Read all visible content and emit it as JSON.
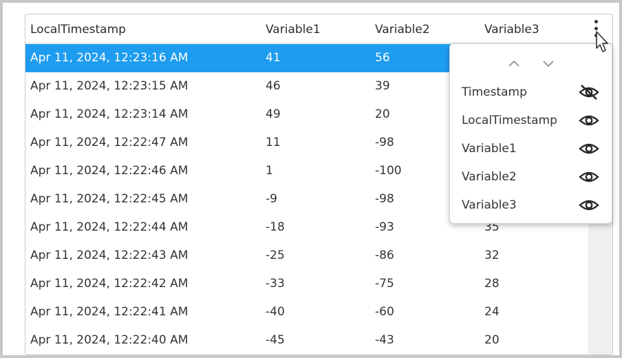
{
  "table": {
    "columns": [
      "LocalTimestamp",
      "Variable1",
      "Variable2",
      "Variable3"
    ],
    "rows": [
      [
        "Apr 11, 2024, 12:23:16 AM",
        "41",
        "56",
        ""
      ],
      [
        "Apr 11, 2024, 12:23:15 AM",
        "46",
        "39",
        ""
      ],
      [
        "Apr 11, 2024, 12:23:14 AM",
        "49",
        "20",
        ""
      ],
      [
        "Apr 11, 2024, 12:22:47 AM",
        "11",
        "-98",
        ""
      ],
      [
        "Apr 11, 2024, 12:22:46 AM",
        "1",
        "-100",
        ""
      ],
      [
        "Apr 11, 2024, 12:22:45 AM",
        "-9",
        "-98",
        ""
      ],
      [
        "Apr 11, 2024, 12:22:44 AM",
        "-18",
        "-93",
        "35"
      ],
      [
        "Apr 11, 2024, 12:22:43 AM",
        "-25",
        "-86",
        "32"
      ],
      [
        "Apr 11, 2024, 12:22:42 AM",
        "-33",
        "-75",
        "28"
      ],
      [
        "Apr 11, 2024, 12:22:41 AM",
        "-40",
        "-60",
        "24"
      ],
      [
        "Apr 11, 2024, 12:22:40 AM",
        "-45",
        "-43",
        "20"
      ]
    ],
    "selected_row": 0
  },
  "column_menu": {
    "items": [
      {
        "label": "Timestamp",
        "visible": false,
        "icon": "eye-off-icon"
      },
      {
        "label": "LocalTimestamp",
        "visible": true,
        "icon": "eye-icon"
      },
      {
        "label": "Variable1",
        "visible": true,
        "icon": "eye-icon"
      },
      {
        "label": "Variable2",
        "visible": true,
        "icon": "eye-icon"
      },
      {
        "label": "Variable3",
        "visible": true,
        "icon": "eye-icon"
      }
    ]
  },
  "colors": {
    "selected_row": "#1e9cf0",
    "text": "#333333",
    "scroll_track": "#efefef"
  }
}
